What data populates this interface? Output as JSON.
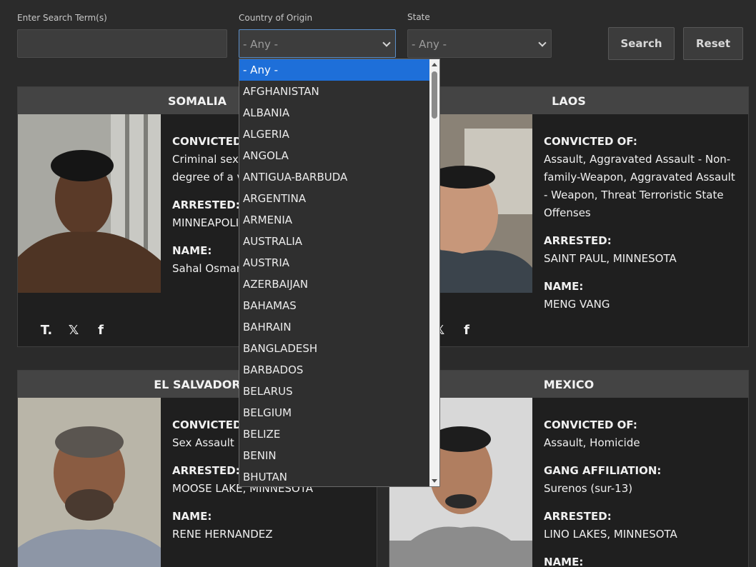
{
  "filters": {
    "search_label": "Enter Search Term(s)",
    "country_label": "Country of Origin",
    "country_value": "- Any -",
    "state_label": "State",
    "state_value": "- Any -",
    "search_button": "Search",
    "reset_button": "Reset"
  },
  "country_options": [
    "- Any -",
    "AFGHANISTAN",
    "ALBANIA",
    "ALGERIA",
    "ANGOLA",
    "ANTIGUA-BARBUDA",
    "ARGENTINA",
    "ARMENIA",
    "AUSTRALIA",
    "AUSTRIA",
    "AZERBAIJAN",
    "BAHAMAS",
    "BAHRAIN",
    "BANGLADESH",
    "BARBADOS",
    "BELARUS",
    "BELGIUM",
    "BELIZE",
    "BENIN",
    "BHUTAN"
  ],
  "cards": [
    {
      "country": "SOMALIA",
      "convicted_label": "CONVICTED OF:",
      "convicted": "Criminal sexual conduct - 3rd degree of a victim",
      "arrested_label": "ARRESTED:",
      "arrested": "MINNEAPOLIS, MINNESOTA",
      "name_label": "NAME:",
      "name": "Sahal Osman",
      "social": {
        "truth": "T.",
        "x": "𝕏",
        "facebook": "f"
      }
    },
    {
      "country": "LAOS",
      "convicted_label": "CONVICTED OF:",
      "convicted": "Assault, Aggravated Assault - Non-family-Weapon, Aggravated Assault - Weapon, Threat Terroristic State Offenses",
      "arrested_label": "ARRESTED:",
      "arrested": "SAINT PAUL, MINNESOTA",
      "name_label": "NAME:",
      "name": "MENG VANG",
      "social": {
        "x": "𝕏",
        "facebook": "f"
      }
    },
    {
      "country": "EL SALVADOR",
      "convicted_label": "CONVICTED OF:",
      "convicted": "Sex Assault",
      "arrested_label": "ARRESTED:",
      "arrested": "MOOSE LAKE, MINNESOTA",
      "name_label": "NAME:",
      "name": "RENE HERNANDEZ"
    },
    {
      "country": "MEXICO",
      "convicted_label": "CONVICTED OF:",
      "convicted": "Assault, Homicide",
      "gang_label": "GANG AFFILIATION:",
      "gang": "Surenos (sur-13)",
      "arrested_label": "ARRESTED:",
      "arrested": "LINO LAKES, MINNESOTA",
      "name_label": "NAME:"
    }
  ]
}
